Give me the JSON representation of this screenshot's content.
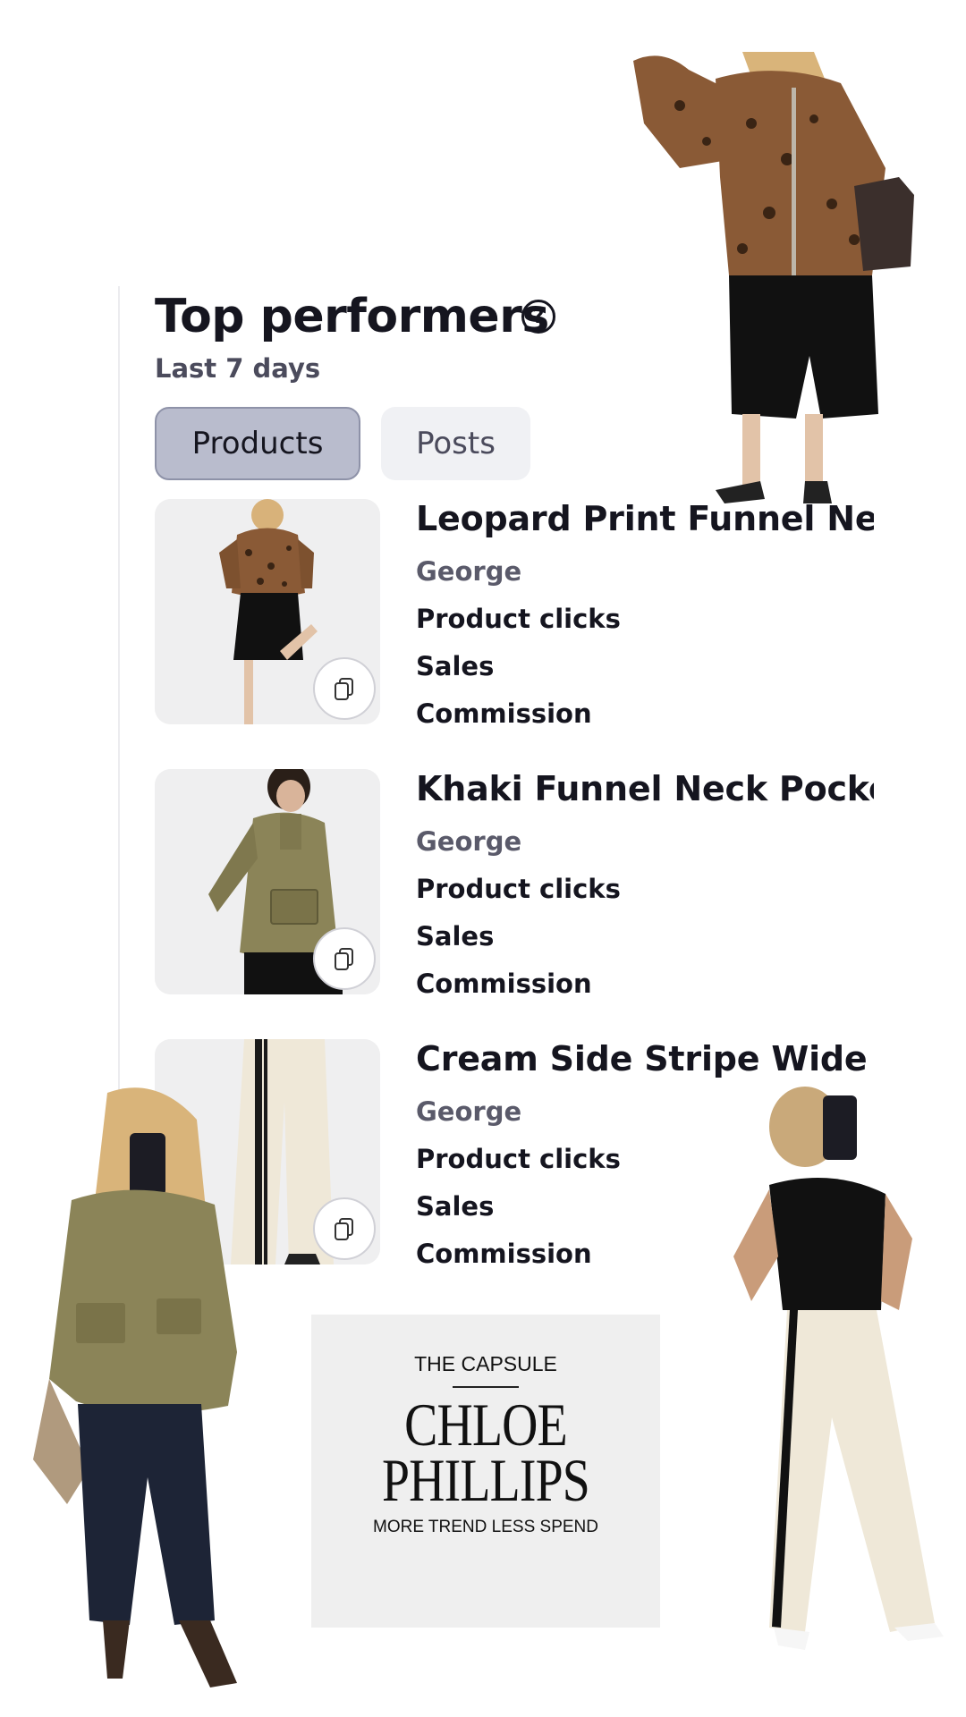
{
  "header": {
    "title": "Top performers",
    "help_icon_glyph": "?",
    "subtitle": "Last 7 days"
  },
  "tabs": [
    {
      "label": "Products",
      "active": true
    },
    {
      "label": "Posts",
      "active": false
    }
  ],
  "products": [
    {
      "title": "Leopard Print Funnel Neck",
      "brand": "George",
      "metric_clicks": "Product clicks",
      "metric_sales": "Sales",
      "metric_commission": "Commission",
      "icon": "copy-icon"
    },
    {
      "title": "Khaki Funnel Neck Pocket J",
      "brand": "George",
      "metric_clicks": "Product clicks",
      "metric_sales": "Sales",
      "metric_commission": "Commission",
      "icon": "copy-icon"
    },
    {
      "title": "Cream Side Stripe Wide Le",
      "brand": "George",
      "metric_clicks": "Product clicks",
      "metric_sales": "Sales",
      "metric_commission": "Commission",
      "icon": "copy-icon"
    }
  ],
  "capsule": {
    "top_line": "THE CAPSULE",
    "name_line1": "CHLOE",
    "name_line2": "PHILLIPS",
    "tagline": "MORE TREND LESS SPEND"
  },
  "colors": {
    "active_tab_bg": "#b9bccd",
    "inactive_tab_bg": "#f0f1f4",
    "text_primary": "#15151f",
    "text_secondary": "#5a5a6a",
    "leopard": "#8a5a36",
    "khaki": "#8b8458",
    "cream": "#efe8d8"
  }
}
